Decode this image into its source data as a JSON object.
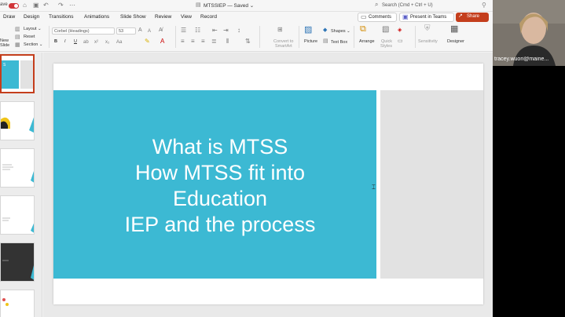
{
  "titlebar": {
    "autosave_label": "ave",
    "doc_title": "MTSSIEP — Saved ⌄",
    "search_placeholder": "Search (Cmd + Ctrl + U)"
  },
  "menu": {
    "items": [
      "Draw",
      "Design",
      "Transitions",
      "Animations",
      "Slide Show",
      "Review",
      "View",
      "Record"
    ]
  },
  "actions": {
    "comments": "Comments",
    "present_teams": "Present in Teams",
    "share": "Share"
  },
  "ribbon": {
    "new_slide_1": "New",
    "new_slide_2": "Slide",
    "layout": "Layout ⌄",
    "reset": "Reset",
    "section": "Section ⌄",
    "font_name": "Corbel (Headings)",
    "font_size": "53",
    "bold": "B",
    "italic": "I",
    "underline": "U",
    "convert_1": "Convert to",
    "convert_2": "SmartArt",
    "picture": "Picture",
    "shapes": "Shapes ⌄",
    "textbox": "Text Box",
    "arrange": "Arrange",
    "quick_1": "Quick",
    "quick_2": "Styles",
    "sensitivity": "Sensitivity",
    "designer": "Designer"
  },
  "slide": {
    "title_lines": [
      "What is MTSS",
      "How MTSS fit into",
      "Education",
      "IEP and the process"
    ]
  },
  "thumbnails": {
    "t1_text": "S"
  },
  "video": {
    "participant": "tracey.wuori@maine..."
  },
  "colors": {
    "accent_teal": "#3cb9d3",
    "share_red": "#c43e1c"
  }
}
